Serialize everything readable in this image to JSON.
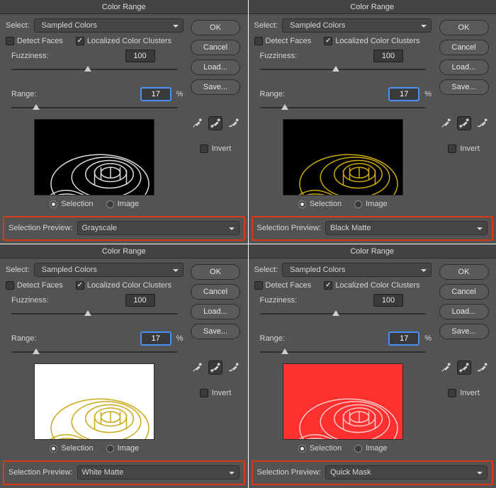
{
  "dialogs": [
    {
      "title": "Color Range",
      "select_label": "Select:",
      "select_value": "Sampled Colors",
      "detect_faces": {
        "label": "Detect Faces",
        "checked": false
      },
      "clusters": {
        "label": "Localized Color Clusters",
        "checked": true
      },
      "fuzziness": {
        "label": "Fuzziness:",
        "value": "100",
        "thumb_pct": 46
      },
      "range": {
        "label": "Range:",
        "value": "17",
        "pct_label": "%",
        "thumb_pct": 15
      },
      "radio": {
        "selection": "Selection",
        "image": "Image",
        "on": "selection"
      },
      "selection_preview": {
        "label": "Selection Preview:",
        "value": "Grayscale"
      },
      "buttons": {
        "ok": "OK",
        "cancel": "Cancel",
        "load": "Load...",
        "save": "Save..."
      },
      "invert": {
        "label": "Invert",
        "checked": false
      },
      "preview_bg": "#000000",
      "spiral_stroke": "#e8e8e8",
      "spiral_fill": "none"
    },
    {
      "title": "Color Range",
      "select_label": "Select:",
      "select_value": "Sampled Colors",
      "detect_faces": {
        "label": "Detect Faces",
        "checked": false
      },
      "clusters": {
        "label": "Localized Color Clusters",
        "checked": true
      },
      "fuzziness": {
        "label": "Fuzziness:",
        "value": "100",
        "thumb_pct": 46
      },
      "range": {
        "label": "Range:",
        "value": "17",
        "pct_label": "%",
        "thumb_pct": 15
      },
      "radio": {
        "selection": "Selection",
        "image": "Image",
        "on": "selection"
      },
      "selection_preview": {
        "label": "Selection Preview:",
        "value": "Black Matte"
      },
      "buttons": {
        "ok": "OK",
        "cancel": "Cancel",
        "load": "Load...",
        "save": "Save..."
      },
      "invert": {
        "label": "Invert",
        "checked": false
      },
      "preview_bg": "#000000",
      "spiral_stroke": "#d9b50a",
      "spiral_fill": "none"
    },
    {
      "title": "Color Range",
      "select_label": "Select:",
      "select_value": "Sampled Colors",
      "detect_faces": {
        "label": "Detect Faces",
        "checked": false
      },
      "clusters": {
        "label": "Localized Color Clusters",
        "checked": true
      },
      "fuzziness": {
        "label": "Fuzziness:",
        "value": "100",
        "thumb_pct": 46
      },
      "range": {
        "label": "Range:",
        "value": "17",
        "pct_label": "%",
        "thumb_pct": 15
      },
      "radio": {
        "selection": "Selection",
        "image": "Image",
        "on": "selection"
      },
      "selection_preview": {
        "label": "Selection Preview:",
        "value": "White Matte"
      },
      "buttons": {
        "ok": "OK",
        "cancel": "Cancel",
        "load": "Load...",
        "save": "Save..."
      },
      "invert": {
        "label": "Invert",
        "checked": false
      },
      "preview_bg": "#ffffff",
      "spiral_stroke": "#c9a40a",
      "spiral_fill": "none"
    },
    {
      "title": "Color Range",
      "select_label": "Select:",
      "select_value": "Sampled Colors",
      "detect_faces": {
        "label": "Detect Faces",
        "checked": false
      },
      "clusters": {
        "label": "Localized Color Clusters",
        "checked": true
      },
      "fuzziness": {
        "label": "Fuzziness:",
        "value": "100",
        "thumb_pct": 46
      },
      "range": {
        "label": "Range:",
        "value": "17",
        "pct_label": "%",
        "thumb_pct": 15
      },
      "radio": {
        "selection": "Selection",
        "image": "Image",
        "on": "selection"
      },
      "selection_preview": {
        "label": "Selection Preview:",
        "value": "Quick Mask"
      },
      "buttons": {
        "ok": "OK",
        "cancel": "Cancel",
        "load": "Load...",
        "save": "Save..."
      },
      "invert": {
        "label": "Invert",
        "checked": false
      },
      "preview_bg": "#ff3030",
      "spiral_stroke": "#ffd0d0",
      "spiral_fill": "none"
    }
  ]
}
